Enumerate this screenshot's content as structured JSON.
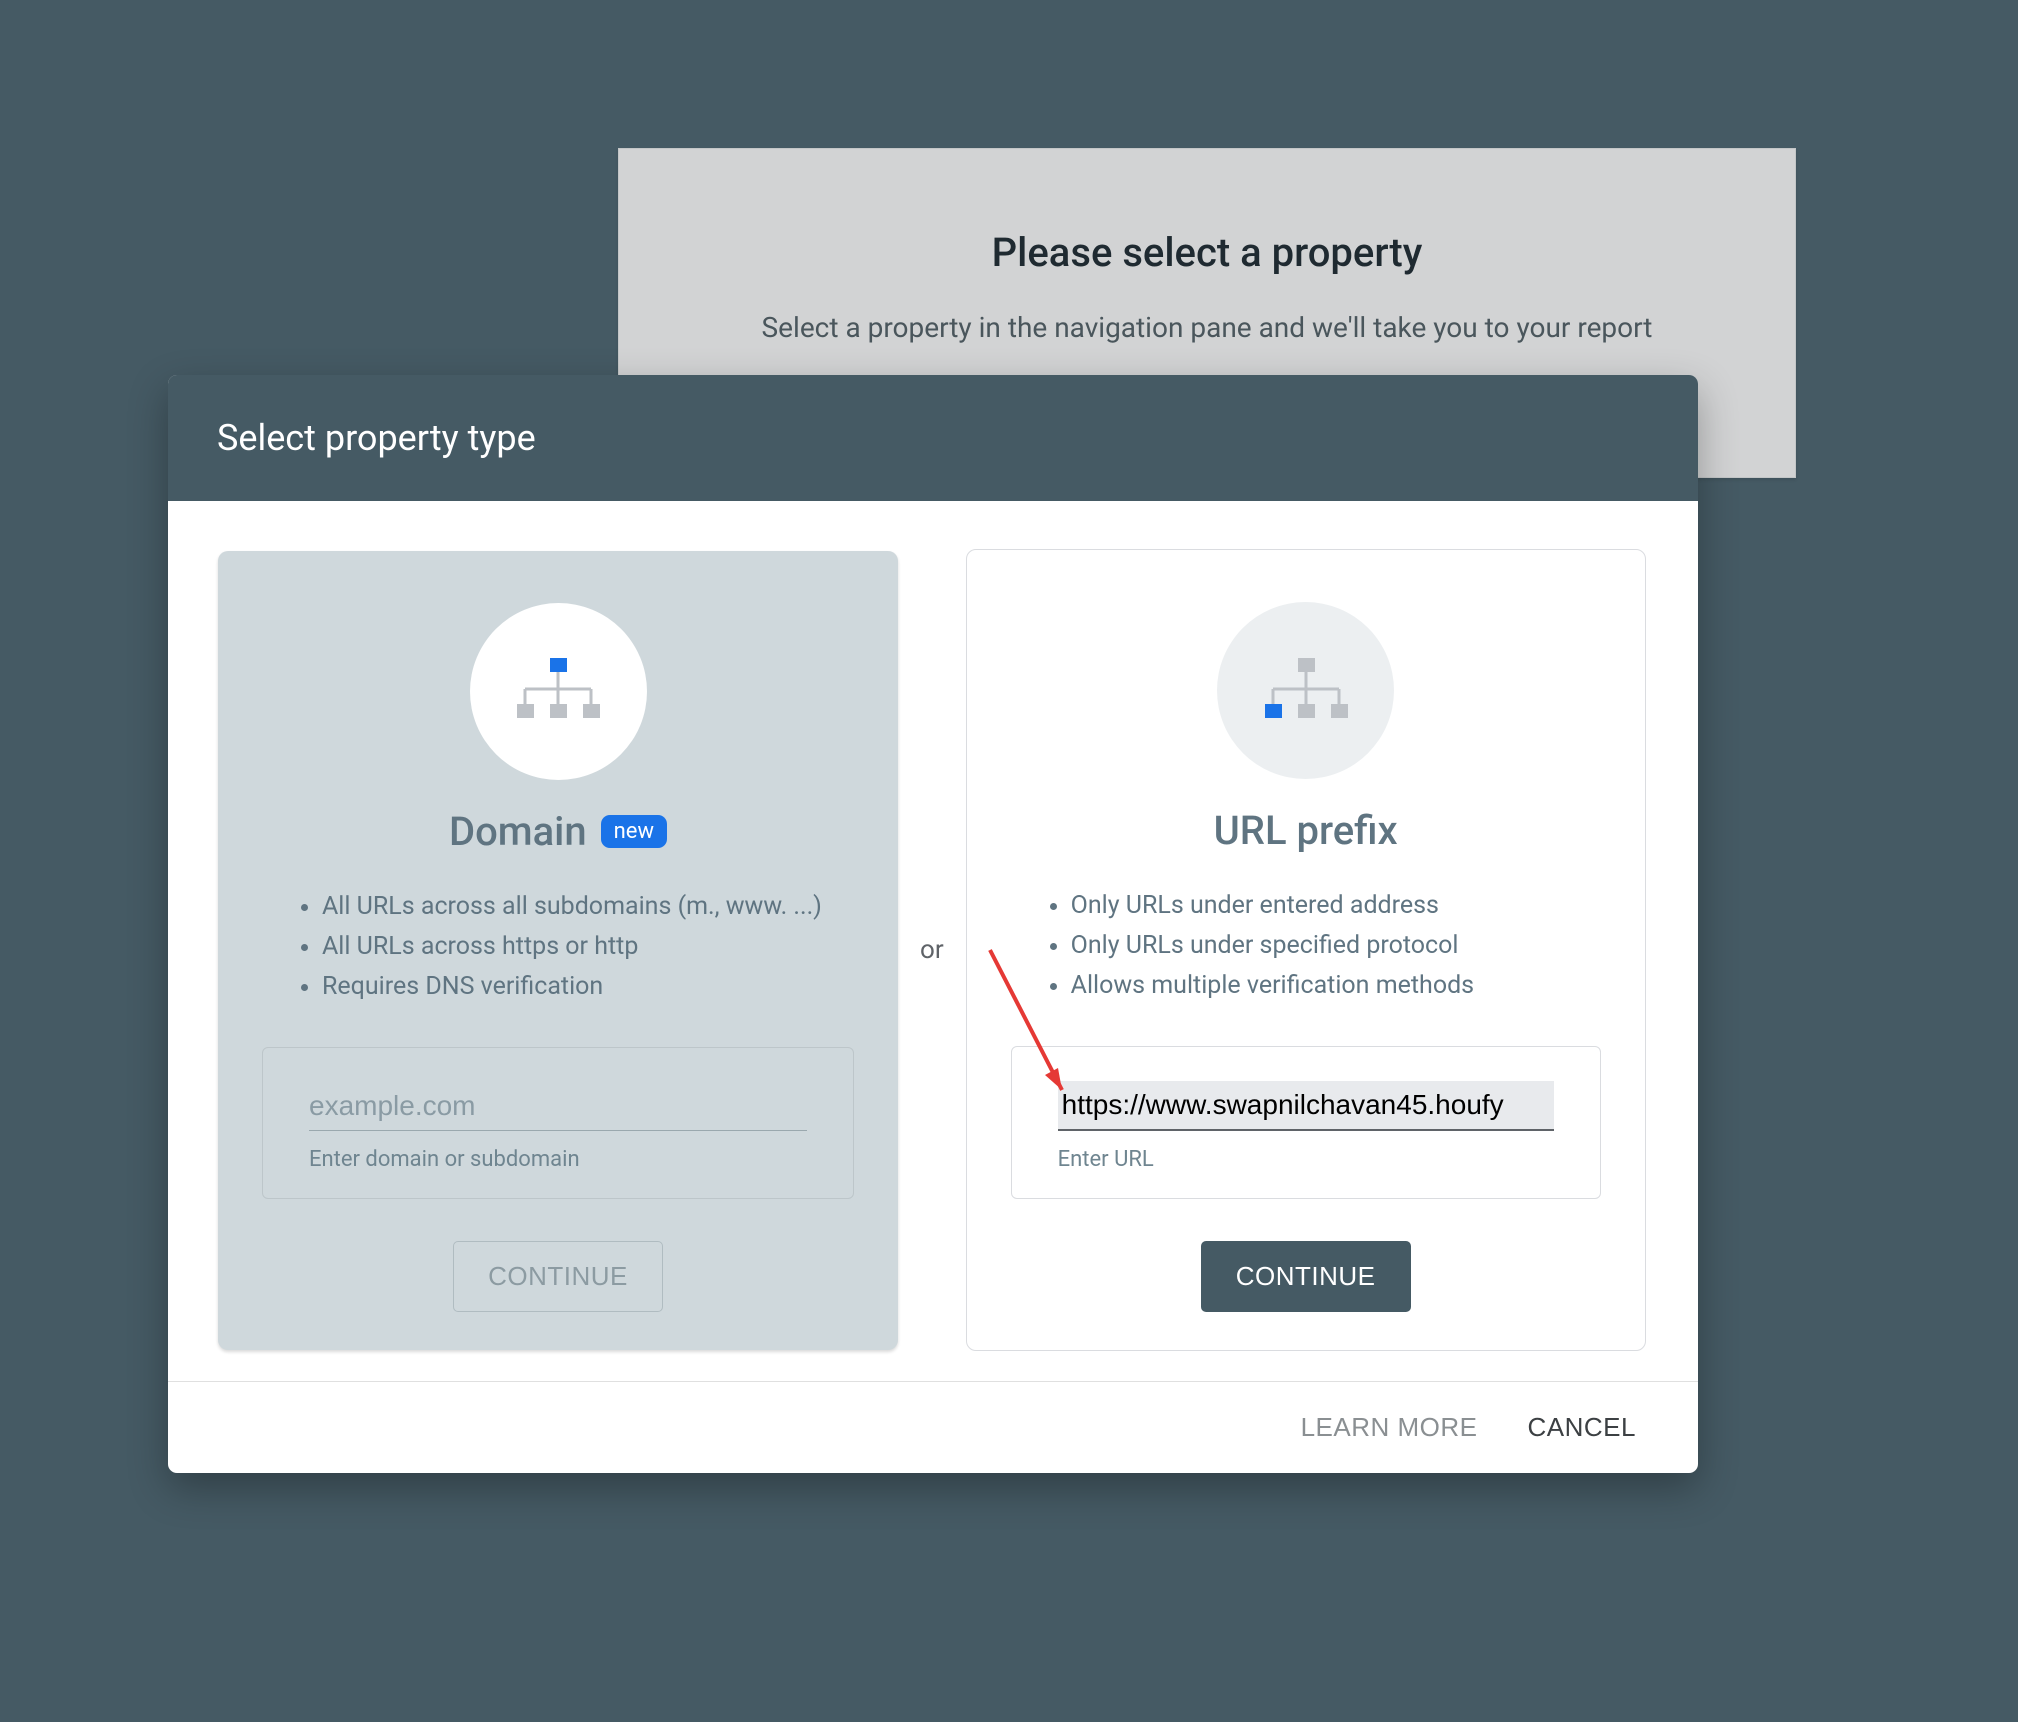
{
  "background": {
    "title": "Please select a property",
    "subtitle": "Select a property in the navigation pane and we'll take you to your report"
  },
  "dialog": {
    "title": "Select property type",
    "or_label": "or",
    "domain": {
      "title": "Domain",
      "badge": "new",
      "features": [
        "All URLs across all subdomains (m., www. ...)",
        "All URLs across https or http",
        "Requires DNS verification"
      ],
      "placeholder": "example.com",
      "helper": "Enter domain or subdomain",
      "continue": "CONTINUE"
    },
    "urlprefix": {
      "title": "URL prefix",
      "features": [
        "Only URLs under entered address",
        "Only URLs under specified protocol",
        "Allows multiple verification methods"
      ],
      "value": "https://www.swapnilchavan45.houfy",
      "helper": "Enter URL",
      "continue": "CONTINUE"
    },
    "footer": {
      "learn_more": "LEARN MORE",
      "cancel": "CANCEL"
    }
  }
}
